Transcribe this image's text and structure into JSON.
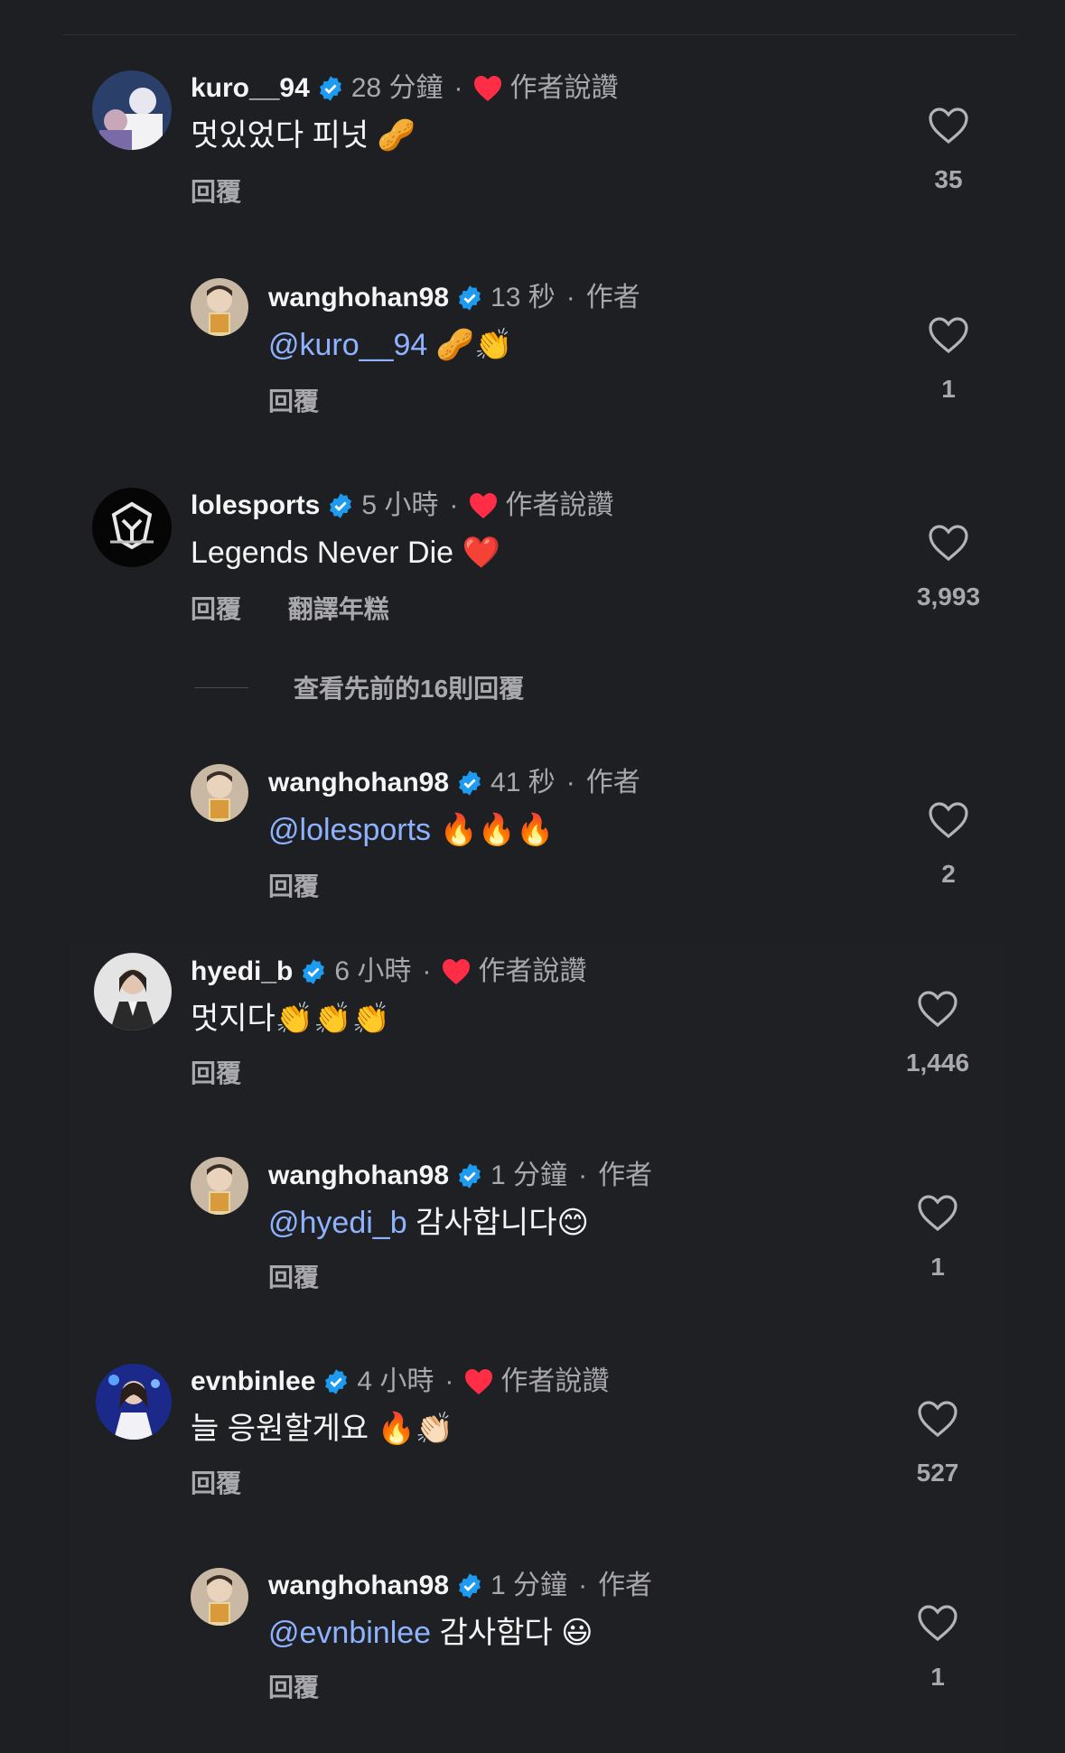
{
  "comments": [
    {
      "username": "kuro__94",
      "time": "28 分鐘",
      "dot": "·",
      "liked_label": "作者說讚",
      "text": "멋있었다 피넛",
      "emoji": "🥜",
      "actions": [
        "回覆"
      ],
      "likes": "35"
    },
    {
      "username": "wanghohan98",
      "time": "13 秒",
      "dot": "·",
      "author_label": "作者",
      "mention": "@kuro__94",
      "text": "",
      "emoji": "🥜👏",
      "actions": [
        "回覆"
      ],
      "likes": "1"
    },
    {
      "username": "lolesports",
      "time": "5 小時",
      "dot": "·",
      "liked_label": "作者說讚",
      "text": "Legends Never Die",
      "emoji": "❤️",
      "actions": [
        "回覆",
        "翻譯年糕"
      ],
      "likes": "3,993"
    },
    {
      "username": "wanghohan98",
      "time": "41 秒",
      "dot": "·",
      "author_label": "作者",
      "mention": "@lolesports",
      "text": "",
      "emoji": "🔥🔥🔥",
      "actions": [
        "回覆"
      ],
      "likes": "2"
    },
    {
      "username": "hyedi_b",
      "time": "6 小時",
      "dot": "·",
      "liked_label": "作者說讚",
      "text": "멋지다",
      "emoji": "👏👏👏",
      "actions": [
        "回覆"
      ],
      "likes": "1,446"
    },
    {
      "username": "wanghohan98",
      "time": "1 分鐘",
      "dot": "·",
      "author_label": "作者",
      "mention": "@hyedi_b",
      "text": "감사합니다",
      "emoji": "😊",
      "actions": [
        "回覆"
      ],
      "likes": "1"
    },
    {
      "username": "evnbinlee",
      "time": "4 小時",
      "dot": "·",
      "liked_label": "作者說讚",
      "text": "늘 응원할게요",
      "emoji": "🔥👏🏻",
      "actions": [
        "回覆"
      ],
      "likes": "527"
    },
    {
      "username": "wanghohan98",
      "time": "1 分鐘",
      "dot": "·",
      "author_label": "作者",
      "mention": "@evnbinlee",
      "text": "감사함다",
      "emoji": "😃",
      "actions": [
        "回覆"
      ],
      "likes": "1"
    }
  ],
  "view_more_replies": "查看先前的16則回覆",
  "colors": {
    "background": "#1e1f22",
    "verified_badge": "#1d9bf0",
    "author_heart": "#ff2d45",
    "mention": "#8fb2ff",
    "secondary_text": "#a8a8ad"
  },
  "icons": {
    "verified": "verified-badge-icon",
    "author_like": "red-heart-icon",
    "like": "heart-outline-icon"
  }
}
